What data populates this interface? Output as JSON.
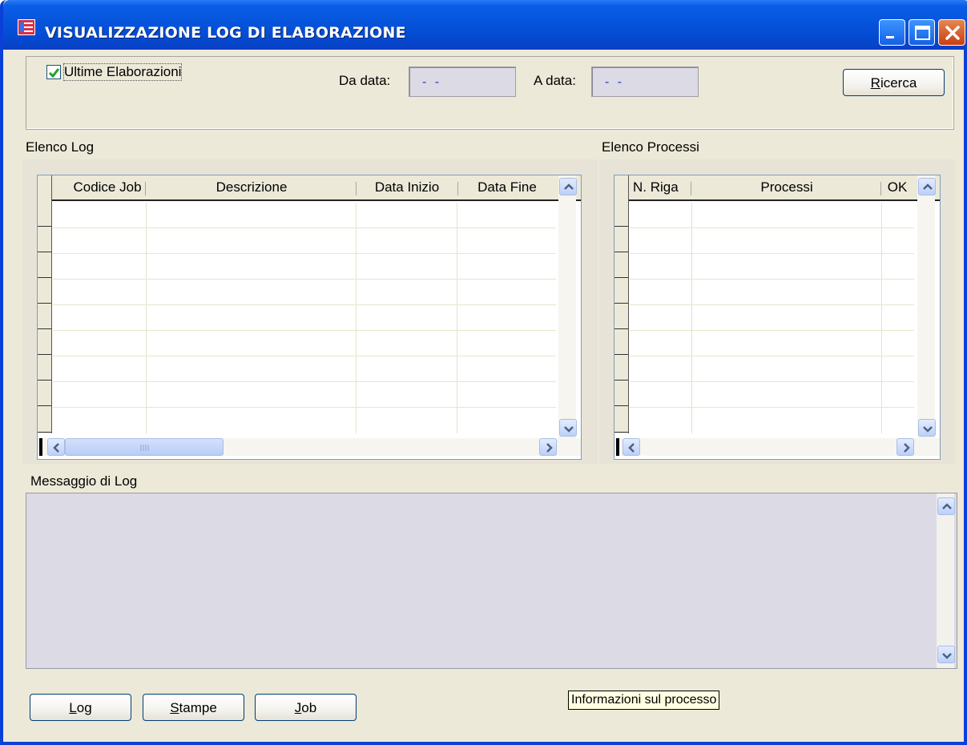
{
  "window": {
    "title": "VISUALIZZAZIONE LOG DI ELABORAZIONE"
  },
  "filters": {
    "ultime_label": "Ultime Elaborazioni",
    "ultime_checked": true,
    "da_data_label": "Da data:",
    "da_data_value": "- -",
    "a_data_label": "A data:",
    "a_data_value": "- -",
    "ricerca_button": "Ricerca"
  },
  "log_panel": {
    "title": "Elenco Log",
    "columns": [
      "Codice Job",
      "Descrizione",
      "Data Inizio",
      "Data Fine"
    ]
  },
  "process_panel": {
    "title": "Elenco Processi",
    "columns": [
      "N. Riga",
      "Processi",
      "OK"
    ]
  },
  "message": {
    "title": "Messaggio di Log"
  },
  "buttons": {
    "log": "Log",
    "stampe": "Stampe",
    "job": "Job"
  },
  "tooltip": "Informazioni sul processo",
  "colors": {
    "titlebar": "#0a5de6",
    "window_bg": "#ece9d8",
    "field_bg": "#dcdae4",
    "date_text": "#1a3cc4"
  }
}
